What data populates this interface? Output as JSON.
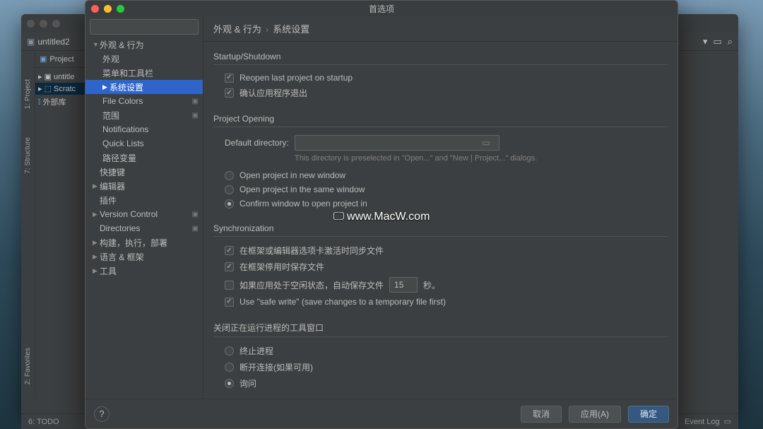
{
  "main_window": {
    "project_name": "untitled2",
    "project_panel_header": "Project",
    "tree": {
      "root": "untitle",
      "scratches": "Scratc",
      "external": "外部库"
    },
    "gutter": {
      "project": "1: Project",
      "structure": "7: Structure",
      "favorites": "2: Favorites"
    },
    "bottom": {
      "todo": "6: TODO",
      "event_log": "Event Log"
    }
  },
  "pref": {
    "title": "首选项",
    "search_placeholder": "",
    "breadcrumb": {
      "a": "外观 & 行为",
      "b": "系统设置"
    },
    "nav": {
      "appearance_behavior": "外观 & 行为",
      "appearance": "外观",
      "menus_toolbars": "菜单和工具栏",
      "system_settings": "系统设置",
      "file_colors": "File Colors",
      "scopes": "范围",
      "notifications": "Notifications",
      "quick_lists": "Quick Lists",
      "path_variables": "路径变量",
      "keymap": "快捷键",
      "editor": "编辑器",
      "plugins": "插件",
      "version_control": "Version Control",
      "directories": "Directories",
      "build": "构建，执行，部署",
      "languages": "语言 & 框架",
      "tools": "工具"
    },
    "sections": {
      "startup": {
        "title": "Startup/Shutdown",
        "reopen": "Reopen last project on startup",
        "confirm_exit": "确认应用程序退出"
      },
      "project_opening": {
        "title": "Project Opening",
        "default_dir_label": "Default directory:",
        "default_dir_value": "",
        "hint": "This directory is preselected in \"Open...\" and \"New | Project...\" dialogs.",
        "new_window": "Open project in new window",
        "same_window": "Open project in the same window",
        "confirm": "Confirm window to open project in"
      },
      "sync": {
        "title": "Synchronization",
        "sync_on_activation": "在框架或编辑器选项卡激活时同步文件",
        "save_on_deactivation": "在框架停用时保存文件",
        "autosave_prefix": "如果应用处于空闲状态，自动保存文件",
        "autosave_value": "15",
        "autosave_suffix": "秒。",
        "safe_write": "Use \"safe write\" (save changes to a temporary file first)"
      },
      "close_tool": {
        "title": "关闭正在运行进程的工具窗口",
        "terminate": "终止进程",
        "disconnect": "断开连接(如果可用)",
        "ask": "询问"
      }
    },
    "buttons": {
      "help": "?",
      "cancel": "取消",
      "apply": "应用(A)",
      "ok": "确定"
    }
  },
  "watermark": "www.MacW.com"
}
